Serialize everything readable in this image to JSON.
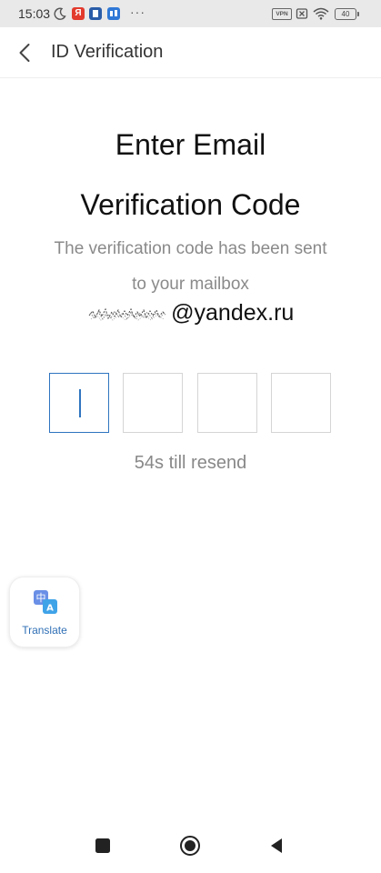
{
  "status_bar": {
    "time": "15:03",
    "vpn_label": "VPN",
    "battery": "40",
    "more": "···",
    "yandex_badge": "Я"
  },
  "header": {
    "title": "ID Verification",
    "back_icon": "chevron-left-icon"
  },
  "content": {
    "title_line1": "Enter Email",
    "title_line2": "Verification Code",
    "subtitle_line1": "The verification code has been sent",
    "subtitle_line2": "to your mailbox",
    "email_domain": "@yandex.ru",
    "resend_text": "54s till resend",
    "code_digits": [
      "",
      "",
      "",
      ""
    ]
  },
  "floating": {
    "translate_label": "Translate",
    "translate_icon": "translate-icon"
  },
  "nav": {
    "recents_icon": "square-icon",
    "home_icon": "circle-home-icon",
    "back_icon": "triangle-back-icon"
  },
  "colors": {
    "accent": "#2f74c0",
    "status_bar_bg": "#e9e9e9"
  }
}
